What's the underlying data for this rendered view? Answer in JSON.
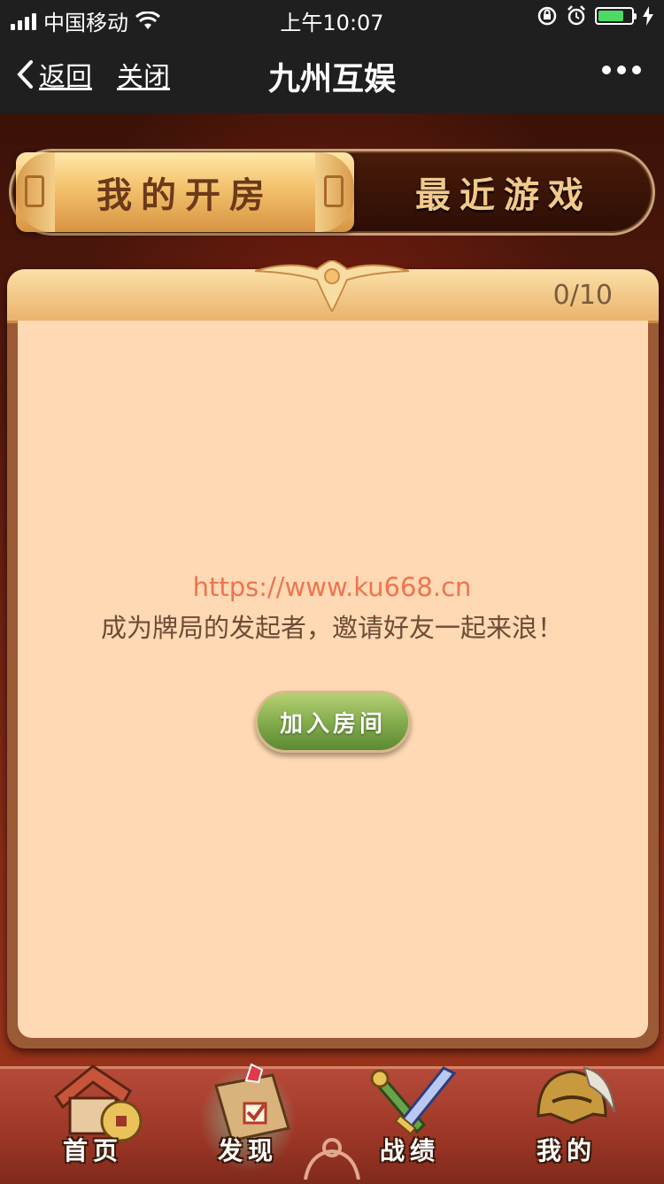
{
  "status_bar": {
    "carrier": "中国移动",
    "time": "上午10:07",
    "battery_level": 0.7,
    "battery_color": "#4cd964"
  },
  "nav": {
    "back_label": "返回",
    "close_label": "关闭",
    "title": "九州互娱",
    "more_icon": "ellipsis-icon"
  },
  "tabs": [
    {
      "label": "我的开房",
      "active": true
    },
    {
      "label": "最近游戏",
      "active": false
    }
  ],
  "panel": {
    "count": "0/10",
    "watermark": "https://www.ku668.cn",
    "empty_message": "成为牌局的发起者，邀请好友一起来浪！",
    "join_button": "加入房间"
  },
  "bottom_nav": [
    {
      "label": "首页",
      "icon": "house-icon",
      "active": false
    },
    {
      "label": "发现",
      "icon": "discover-board-icon",
      "active": true
    },
    {
      "label": "战绩",
      "icon": "sword-scroll-icon",
      "active": false
    },
    {
      "label": "我的",
      "icon": "helmet-icon",
      "active": false
    }
  ],
  "colors": {
    "accent_gold": "#f3c16c",
    "panel_bg": "#ffd9b3",
    "button_green": "#7fa94a"
  }
}
